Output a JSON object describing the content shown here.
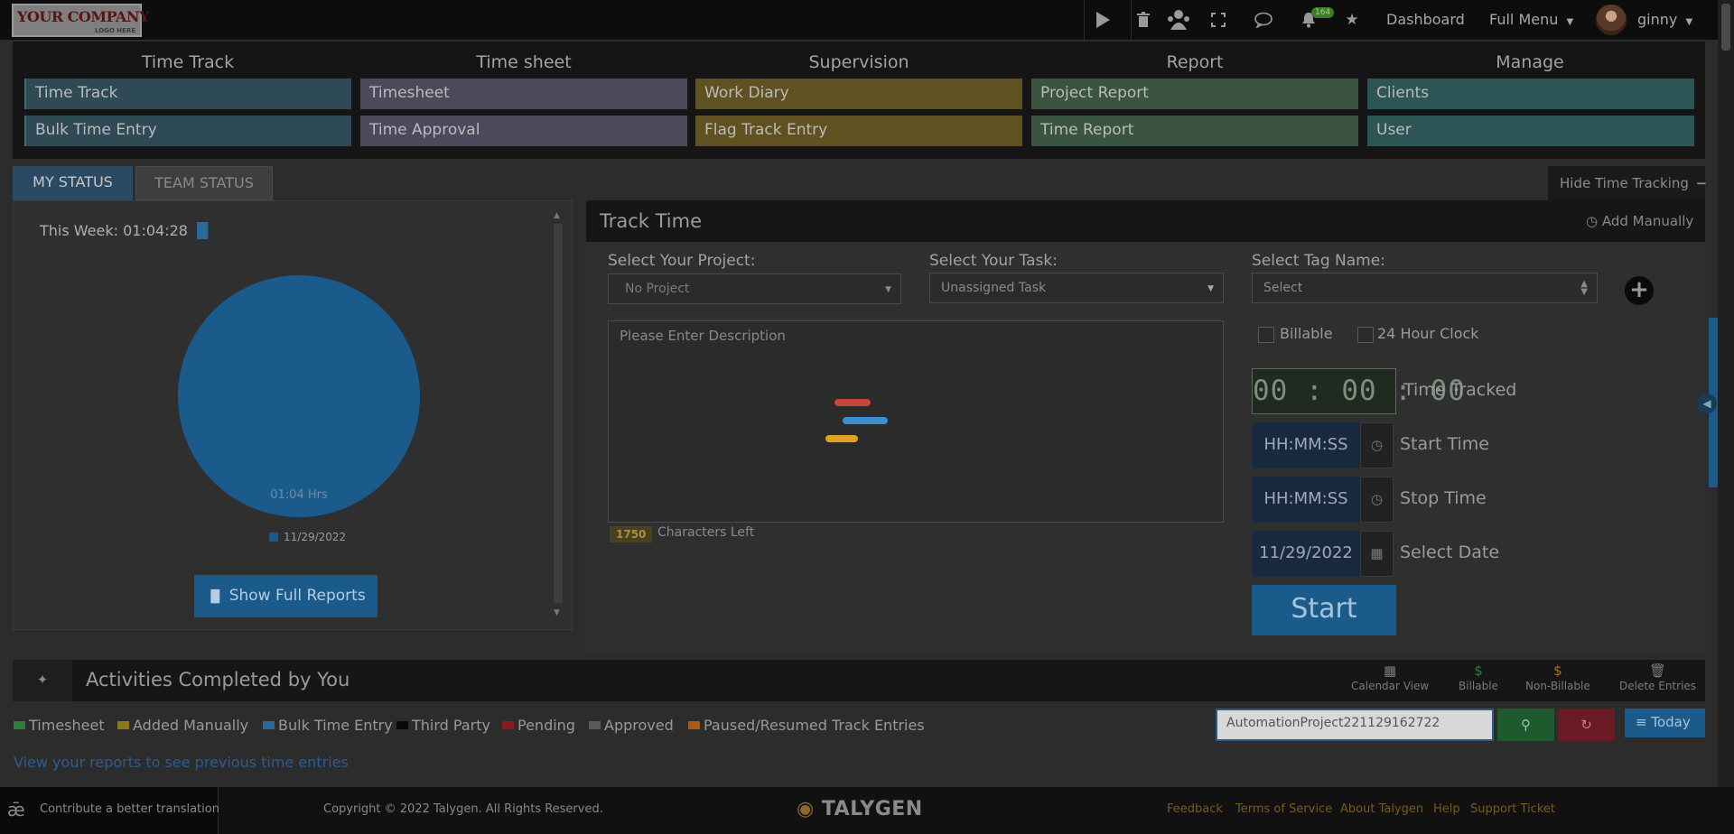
{
  "header": {
    "logo": {
      "line1": "YOUR COMPANY",
      "line2": "LOGO HERE"
    },
    "notification_count": "164",
    "dashboard_label": "Dashboard",
    "full_menu_label": "Full Menu",
    "user_name": "ginny"
  },
  "nav": {
    "columns": [
      {
        "heading": "Time Track",
        "items": [
          "Time Track",
          "Bulk Time Entry"
        ]
      },
      {
        "heading": "Time sheet",
        "items": [
          "Timesheet",
          "Time Approval"
        ]
      },
      {
        "heading": "Supervision",
        "items": [
          "Work Diary",
          "Flag Track Entry"
        ]
      },
      {
        "heading": "Report",
        "items": [
          "Project Report",
          "Time Report"
        ]
      },
      {
        "heading": "Manage",
        "items": [
          "Clients",
          "User"
        ]
      }
    ]
  },
  "status": {
    "tabs": {
      "my": "MY STATUS",
      "team": "TEAM STATUS"
    },
    "hide_tracking": "Hide Time Tracking",
    "this_week_label": "This Week: 01:04:28",
    "pie_label": "01:04 Hrs",
    "legend": "11/29/2022",
    "full_reports_button": "Show Full Reports"
  },
  "track": {
    "title": "Track Time",
    "add_manually": "Add Manually",
    "project_label": "Select Your Project:",
    "project_value": "No Project",
    "task_label": "Select Your Task:",
    "task_value": "Unassigned Task",
    "tag_label": "Select Tag Name:",
    "tag_value": "Select",
    "description_placeholder": "Please Enter Description",
    "chars_left_count": "1750",
    "chars_left_label": "Characters Left",
    "billable_label": "Billable",
    "clock24_label": "24 Hour Clock",
    "time_tracked_value": "00 : 00 : 00",
    "time_tracked_label": "Time Tracked",
    "start_time_value": "HH:MM:SS",
    "start_time_label": "Start Time",
    "stop_time_value": "HH:MM:SS",
    "stop_time_label": "Stop Time",
    "date_value": "11/29/2022",
    "date_label": "Select Date",
    "start_button": "Start"
  },
  "activities": {
    "title": "Activities Completed by You",
    "tools": [
      "Calendar View",
      "Billable",
      "Non-Billable",
      "Delete Entries"
    ],
    "legend": [
      {
        "label": "Timesheet",
        "color": "#2e7d3a"
      },
      {
        "label": "Added Manually",
        "color": "#8a7a18"
      },
      {
        "label": "Bulk Time Entry",
        "color": "#2a6a9a"
      },
      {
        "label": "Third Party",
        "color": "#0a0a0a"
      },
      {
        "label": "Pending",
        "color": "#8a1a22"
      },
      {
        "label": "Approved",
        "color": "#5a5a5a"
      },
      {
        "label": "Paused/Resumed Track Entries",
        "color": "#a85a1a"
      }
    ],
    "search_value": "AutomationProject221129162722",
    "today_button": "Today",
    "view_reports_link": "View your reports to see previous time entries"
  },
  "footer": {
    "translate": "Contribute a better translation",
    "copyright": "Copyright © 2022 Talygen. All Rights Reserved.",
    "brand": "TALYGEN",
    "links": [
      "Feedback",
      "Terms of Service",
      "About Talygen",
      "Help",
      "Support Ticket"
    ]
  },
  "colors": {
    "accent": "#1a5b8c",
    "overlay_bg": "#2c2c2c"
  }
}
